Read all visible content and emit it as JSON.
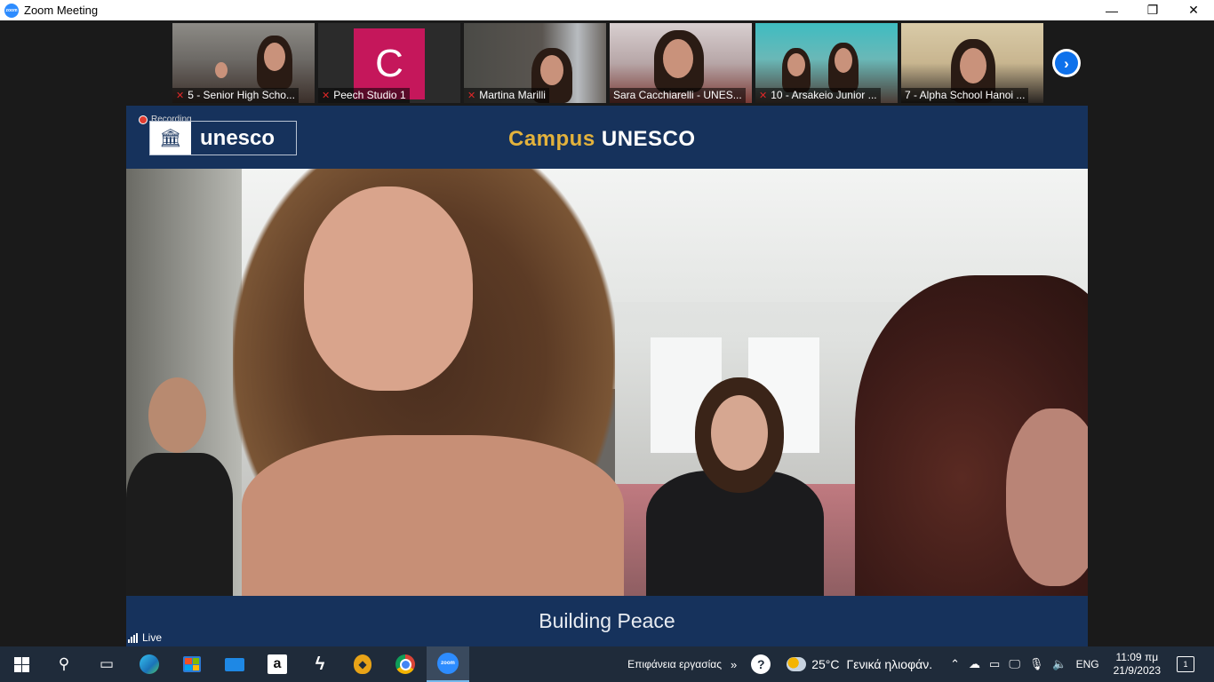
{
  "window": {
    "title": "Zoom Meeting",
    "logo_text": "zoom",
    "minimize": "—",
    "restore": "❐",
    "close": "✕"
  },
  "gallery": {
    "participants": [
      {
        "name": "5 - Senior High Scho...",
        "muted": true
      },
      {
        "name": "Peech Studio 1",
        "muted": true,
        "avatar_letter": "C",
        "avatar_color": "#c5175b"
      },
      {
        "name": "Martina Marilli",
        "muted": true
      },
      {
        "name": "Sara Cacchiarelli - UNES...",
        "muted": false
      },
      {
        "name": "10 - Arsakeio Junior ...",
        "muted": true
      },
      {
        "name": "7 - Alpha School Hanoi ...",
        "muted": false
      }
    ],
    "next_icon": "›"
  },
  "stage": {
    "recording_label": "Recording",
    "logo_word": "unesco",
    "banner_word1": "Campus",
    "banner_word2": "UNESCO",
    "footer_caption": "Building Peace",
    "brand_navy": "#16325c",
    "accent_gold": "#e3b23c"
  },
  "live_label": "Live",
  "taskbar": {
    "apps": [
      "windows-start",
      "search",
      "task-view",
      "edge",
      "microsoft-store",
      "mail",
      "amazon",
      "bolt-app",
      "brave-shield",
      "chrome",
      "zoom"
    ],
    "amazon_letter": "a",
    "zoom_label": "zoom",
    "desktop_label": "Επιφάνεια εργασίας",
    "desktop_chevron": "»",
    "temperature": "25°C",
    "weather_text": "Γενικά ηλιοφάν.",
    "language": "ENG",
    "time": "11:09 πμ",
    "date": "21/9/2023",
    "notification_count": "1"
  }
}
